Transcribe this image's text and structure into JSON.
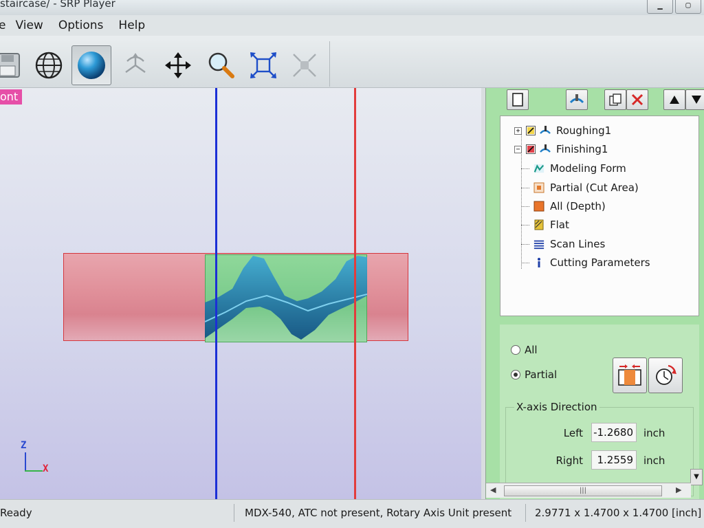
{
  "window": {
    "title": "staircase/ - SRP Player",
    "controls": [
      "▁",
      "▢"
    ]
  },
  "menu": [
    "e",
    "View",
    "Options",
    "Help"
  ],
  "viewport": {
    "view_label": "ont",
    "axis": {
      "z": "Z",
      "x": "X"
    }
  },
  "tree": {
    "items": [
      {
        "label": "Roughing1",
        "expander": "+"
      },
      {
        "label": "Finishing1",
        "expander": "−"
      },
      {
        "label": "Modeling Form"
      },
      {
        "label": "Partial (Cut Area)"
      },
      {
        "label": "All (Depth)"
      },
      {
        "label": "Flat"
      },
      {
        "label": "Scan Lines"
      },
      {
        "label": "Cutting Parameters"
      }
    ]
  },
  "options": {
    "radio_all": "All",
    "radio_partial": "Partial",
    "selected": "Partial",
    "group_title": "X-axis Direction",
    "left_label": "Left",
    "left_value": "-1.2680",
    "right_label": "Right",
    "right_value": "1.2559",
    "unit": "inch"
  },
  "status": {
    "ready": "Ready",
    "machine": "MDX-540, ATC not present, Rotary Axis Unit present",
    "dimensions": "2.9771 x 1.4700 x 1.4700 [inch]"
  },
  "colors": {
    "view_label_bg": "#e64fa8",
    "blue_line": "#1b2fd6",
    "red_line": "#e23c3c",
    "panel_green": "#a7e0a6"
  }
}
